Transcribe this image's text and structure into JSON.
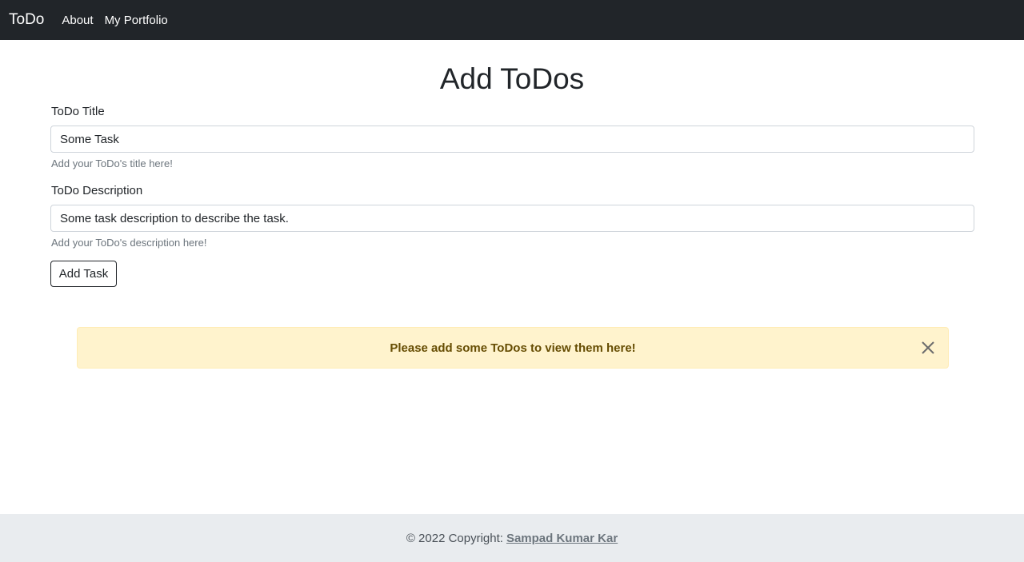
{
  "navbar": {
    "brand": "ToDo",
    "links": [
      "About",
      "My Portfolio"
    ]
  },
  "main": {
    "title": "Add ToDos",
    "title_field": {
      "label": "ToDo Title",
      "value": "Some Task",
      "help": "Add your ToDo's title here!"
    },
    "description_field": {
      "label": "ToDo Description",
      "value": "Some task description to describe the task.",
      "help": "Add your ToDo's description here!"
    },
    "submit_label": "Add Task"
  },
  "alert": {
    "message": "Please add some ToDos to view them here!",
    "icon": "close-icon"
  },
  "footer": {
    "copyright": "© 2022 Copyright:",
    "author": "Sampad Kumar Kar"
  },
  "colors": {
    "navbar_bg": "#212529",
    "alert_bg": "#fff3cd",
    "alert_text": "#664d03",
    "footer_bg": "#e9ecef"
  }
}
